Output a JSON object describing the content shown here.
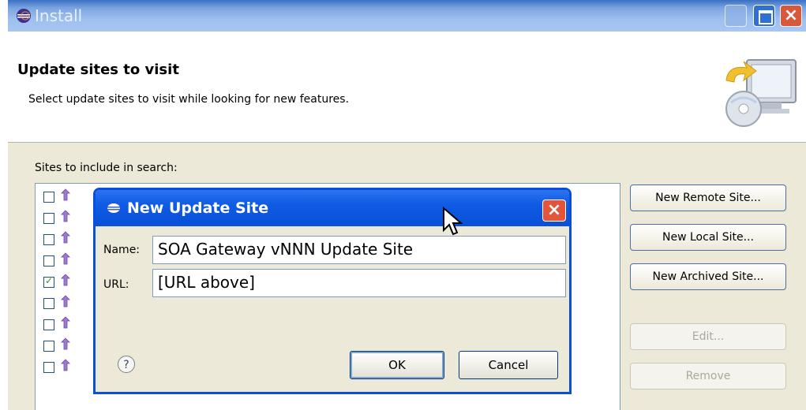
{
  "window": {
    "title": "Install",
    "heading": "Update sites to visit",
    "description": "Select update sites to visit while looking for new features.",
    "sites_label": "Sites to include in search:"
  },
  "site_list": {
    "rows": [
      {
        "checked": false
      },
      {
        "checked": false
      },
      {
        "checked": false
      },
      {
        "checked": false
      },
      {
        "checked": true
      },
      {
        "checked": false
      },
      {
        "checked": false
      },
      {
        "checked": false
      },
      {
        "checked": false
      }
    ]
  },
  "side_buttons": {
    "new_remote": "New Remote Site...",
    "new_local": "New Local Site...",
    "new_archived": "New Archived Site...",
    "edit": "Edit...",
    "remove": "Remove"
  },
  "dialog": {
    "title": "New Update Site",
    "name_label": "Name:",
    "name_value": "SOA Gateway vNNN Update Site",
    "url_label": "URL:",
    "url_value": "[URL above]",
    "ok": "OK",
    "cancel": "Cancel",
    "help_glyph": "?"
  },
  "colors": {
    "dialog_title": "#0a4fd8",
    "close_button": "#e2553a",
    "checkmark": "#21a121"
  }
}
